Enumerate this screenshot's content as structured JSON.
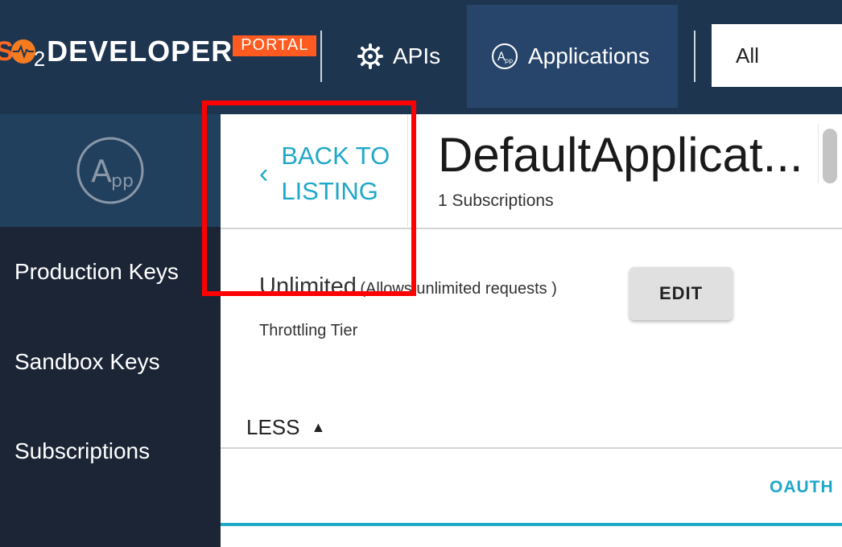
{
  "header": {
    "logo": {
      "so": "S",
      "two": "2",
      "developer": "DEVELOPER",
      "portal": "PORTAL"
    },
    "nav": {
      "apis_label": "APIs",
      "applications_label": "Applications"
    },
    "filter": {
      "selected": "All"
    }
  },
  "sidebar": {
    "items": [
      {
        "label": "Production Keys"
      },
      {
        "label": "Sandbox Keys"
      },
      {
        "label": "Subscriptions"
      }
    ]
  },
  "main": {
    "back_line1": "BACK TO",
    "back_line2": "LISTING",
    "app_title": "DefaultApplicat...",
    "subscriptions": "1 Subscriptions",
    "tier_name": "Unlimited",
    "tier_desc": "(Allows unlimited requests )",
    "tier_label": "Throttling Tier",
    "edit_label": "EDIT",
    "less_label": "LESS",
    "oauth_tab": "OAUTH"
  },
  "colors": {
    "header_bg": "#1e3550",
    "active_nav_bg": "#27456a",
    "sidebar_bg": "#1b2535",
    "accent": "#1fa8c8",
    "portal_badge": "#ff5a1f",
    "highlight": "#ff0000"
  },
  "icons": [
    "apis-gear-icon",
    "applications-app-icon",
    "sidebar-app-icon",
    "back-chevron-icon",
    "sort-up-triangle-icon"
  ]
}
